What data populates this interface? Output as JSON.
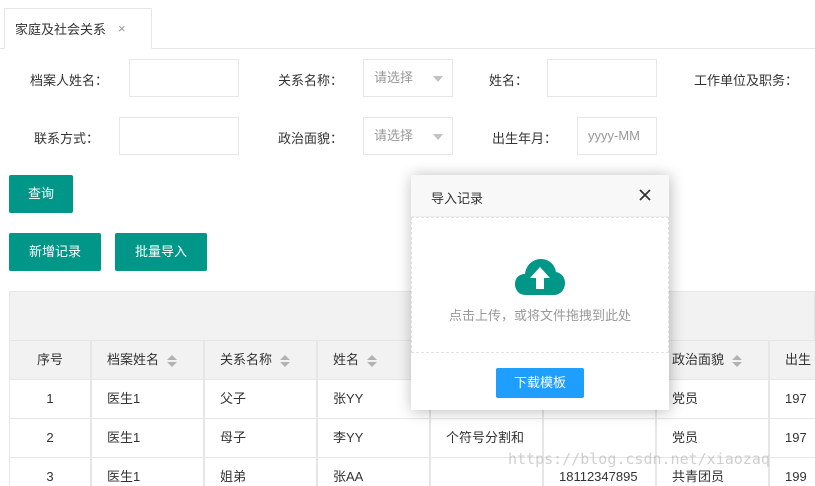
{
  "tab": {
    "label": "家庭及社会关系",
    "close": "×"
  },
  "filters": {
    "archive_name_label": "档案人姓名：",
    "relation_label": "关系名称：",
    "relation_placeholder": "请选择",
    "name_label": "姓名：",
    "work_label": "工作单位及职务：",
    "contact_label": "联系方式：",
    "political_label": "政治面貌：",
    "political_placeholder": "请选择",
    "birth_label": "出生年月：",
    "birth_placeholder": "yyyy-MM"
  },
  "buttons": {
    "query": "查询",
    "add": "新增记录",
    "batch_import": "批量导入"
  },
  "table": {
    "headers": [
      "序号",
      "档案姓名",
      "关系名称",
      "姓名",
      "政治面貌",
      "出生"
    ],
    "rows": [
      {
        "idx": "1",
        "archive": "医生1",
        "relation": "父子",
        "name": "张YY",
        "work": "",
        "phone": "",
        "political": "党员",
        "birth": "197"
      },
      {
        "idx": "2",
        "archive": "医生1",
        "relation": "母子",
        "name": "李YY",
        "work": "个符号分割和",
        "phone": "",
        "political": "党员",
        "birth": "197"
      },
      {
        "idx": "3",
        "archive": "医生1",
        "relation": "姐弟",
        "name": "张AA",
        "work": "",
        "phone": "18112347895",
        "political": "共青团员",
        "birth": "199"
      }
    ]
  },
  "modal": {
    "title": "导入记录",
    "drop_text": "点击上传，或将文件拖拽到此处",
    "download_template": "下载模板",
    "icons": {
      "close": "close-icon",
      "upload": "cloud-upload-icon"
    },
    "colors": {
      "upload_icon": "#009688",
      "button": "#1e9fff"
    }
  },
  "watermark": "https://blog.csdn.net/xiaozaq",
  "colors": {
    "primary": "#009688"
  }
}
